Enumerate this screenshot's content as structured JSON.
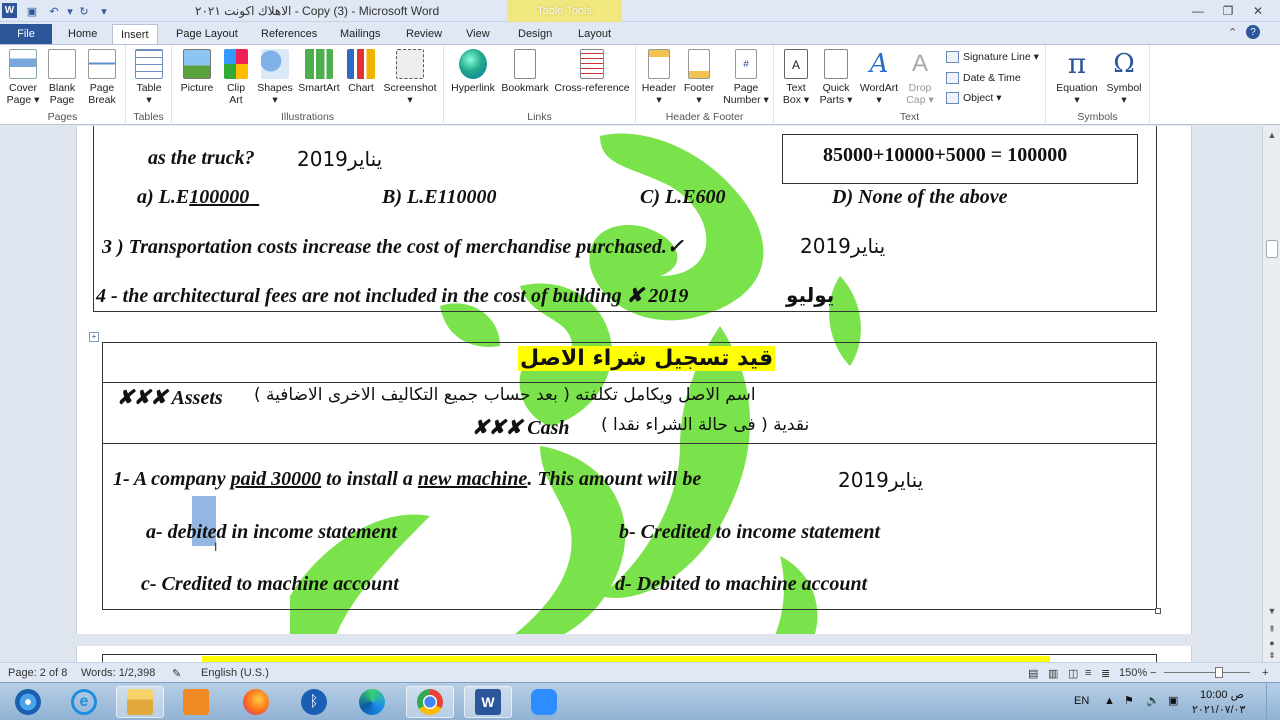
{
  "window": {
    "title": "الاهلاك اكونت ٢٠٢١ - Copy (3)  -  Microsoft Word",
    "contextual_tab": "Table Tools",
    "logo": "W"
  },
  "tabs": [
    {
      "label": "File"
    },
    {
      "label": "Home"
    },
    {
      "label": "Insert",
      "active": true
    },
    {
      "label": "Page Layout"
    },
    {
      "label": "References"
    },
    {
      "label": "Mailings"
    },
    {
      "label": "Review"
    },
    {
      "label": "View"
    },
    {
      "label": "Design"
    },
    {
      "label": "Layout"
    }
  ],
  "ribbon": {
    "groups": {
      "pages": "Pages",
      "tables": "Tables",
      "illustrations": "Illustrations",
      "links": "Links",
      "header_footer": "Header & Footer",
      "text": "Text",
      "symbols": "Symbols"
    },
    "buttons": {
      "cover": "Cover\nPage ▾",
      "blank": "Blank\nPage",
      "break": "Page\nBreak",
      "table": "Table\n▾",
      "picture": "Picture",
      "clipart": "Clip\nArt",
      "shapes": "Shapes\n▾",
      "smartart": "SmartArt",
      "chart": "Chart",
      "screenshot": "Screenshot\n▾",
      "hyperlink": "Hyperlink",
      "bookmark": "Bookmark",
      "crossref": "Cross-reference",
      "header": "Header\n▾",
      "footer": "Footer\n▾",
      "pagenum": "Page\nNumber ▾",
      "textbox": "Text\nBox ▾",
      "quickparts": "Quick\nParts ▾",
      "wordart": "WordArt\n▾",
      "dropcap": "Drop\nCap ▾",
      "equation": "Equation\n▾",
      "symbol": "Symbol\n▾"
    },
    "small": {
      "signature": "Signature Line ▾",
      "datetime": "Date & Time",
      "object": "Object ▾"
    }
  },
  "document": {
    "q_truck": "as the truck?",
    "y2019a": "يناير2019",
    "sum_box": "85000+10000+5000 = 100000",
    "opt_a_pre": "a) L.E",
    "opt_a_val": "100000",
    "opt_b": "B) L.E110000",
    "opt_c": "C) L.E600",
    "opt_d": "D) None of the above",
    "q3_num": "3 )",
    "q3": "Transportation costs increase the cost of merchandise purchased.✓",
    "q3_date": "يناير2019",
    "q4": "4 -  the architectural fees are not included in the cost of building ✘  2019",
    "q4_date": "يوليو",
    "entry_title": "قيد تسجيل شراء الاصل",
    "entry_l1_en": "✘✘✘  Assets",
    "entry_l1_ar": "اسم الاصل ويكامل تكلفته ( بعد حساب جميع التكاليف الاخرى الاضافية )",
    "entry_l2_en": "✘✘✘ Cash",
    "entry_l2_ar": "نقدية ( فى حالة الشراء نقدا )",
    "q1_a": "1- A company",
    "q1_b": "paid  30000",
    "q1_c": "to install a",
    "q1_d": "new machine",
    "q1_e": ". This amount will be",
    "q1_date": "يناير2019",
    "ans_a": "a- debited in income statement",
    "ans_b": "b- Credited to income statement",
    "ans_c": "c- Credited to machine account",
    "ans_d": "d- Debited to machine account"
  },
  "status": {
    "page": "Page: 2 of 8",
    "words": "Words: 1/2,398",
    "lang": "English (U.S.)",
    "zoom": "150%"
  },
  "tray": {
    "lang": "EN",
    "time": "10:00 ص",
    "date": "٢٠٢١/٠٧/٠٣"
  },
  "colors": {
    "accent": "#2b579a",
    "highlight": "#ffff00",
    "watermark": "#6fe03c"
  }
}
